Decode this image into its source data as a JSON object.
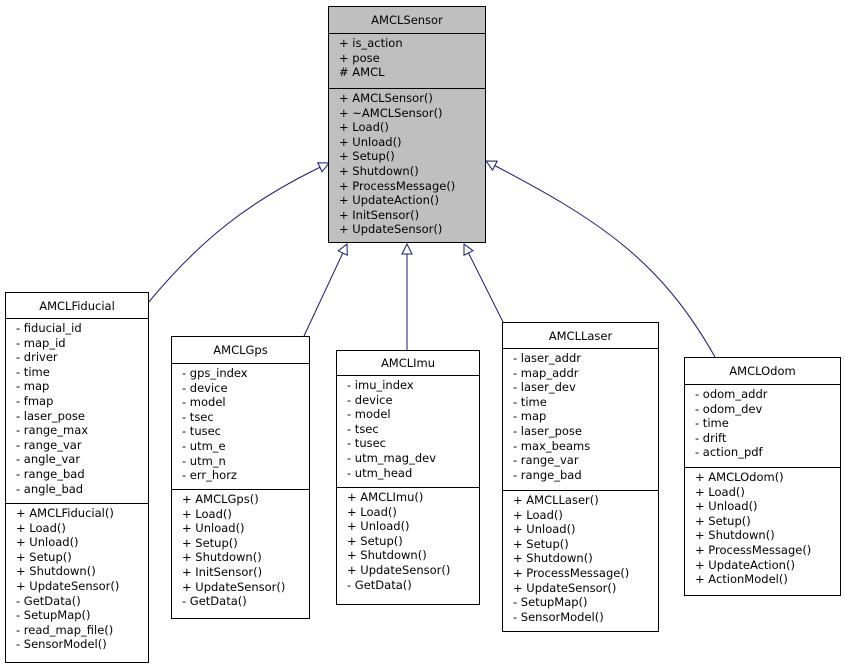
{
  "diagram": {
    "type": "uml-class-inheritance",
    "edge_color": "#191970",
    "base_fill": "#bfbfbf",
    "classes": [
      {
        "id": "AMCLSensor",
        "name": "AMCLSensor",
        "role": "base",
        "attributes": [
          "+ is_action",
          "+ pose",
          "# AMCL"
        ],
        "methods": [
          "+ AMCLSensor()",
          "+ ~AMCLSensor()",
          "+ Load()",
          "+ Unload()",
          "+ Setup()",
          "+ Shutdown()",
          "+ ProcessMessage()",
          "+ UpdateAction()",
          "+ InitSensor()",
          "+ UpdateSensor()"
        ]
      },
      {
        "id": "AMCLFiducial",
        "name": "AMCLFiducial",
        "role": "derived",
        "attributes": [
          "- fiducial_id",
          "- map_id",
          "- driver",
          "- time",
          "- map",
          "- fmap",
          "- laser_pose",
          "- range_max",
          "- range_var",
          "- angle_var",
          "- range_bad",
          "- angle_bad"
        ],
        "methods": [
          "+ AMCLFiducial()",
          "+ Load()",
          "+ Unload()",
          "+ Setup()",
          "+ Shutdown()",
          "+ UpdateSensor()",
          "- GetData()",
          "- SetupMap()",
          "- read_map_file()",
          "- SensorModel()"
        ]
      },
      {
        "id": "AMCLGps",
        "name": "AMCLGps",
        "role": "derived",
        "attributes": [
          "- gps_index",
          "- device",
          "- model",
          "- tsec",
          "- tusec",
          "- utm_e",
          "- utm_n",
          "- err_horz"
        ],
        "methods": [
          "+ AMCLGps()",
          "+ Load()",
          "+ Unload()",
          "+ Setup()",
          "+ Shutdown()",
          "+ InitSensor()",
          "+ UpdateSensor()",
          "- GetData()"
        ]
      },
      {
        "id": "AMCLImu",
        "name": "AMCLImu",
        "role": "derived",
        "attributes": [
          "- imu_index",
          "- device",
          "- model",
          "- tsec",
          "- tusec",
          "- utm_mag_dev",
          "- utm_head"
        ],
        "methods": [
          "+ AMCLImu()",
          "+ Load()",
          "+ Unload()",
          "+ Setup()",
          "+ Shutdown()",
          "+ UpdateSensor()",
          "- GetData()"
        ]
      },
      {
        "id": "AMCLLaser",
        "name": "AMCLLaser",
        "role": "derived",
        "attributes": [
          "- laser_addr",
          "- map_addr",
          "- laser_dev",
          "- time",
          "- map",
          "- laser_pose",
          "- max_beams",
          "- range_var",
          "- range_bad"
        ],
        "methods": [
          "+ AMCLLaser()",
          "+ Load()",
          "+ Unload()",
          "+ Setup()",
          "+ Shutdown()",
          "+ ProcessMessage()",
          "+ UpdateSensor()",
          "- SetupMap()",
          "- SensorModel()"
        ]
      },
      {
        "id": "AMCLOdom",
        "name": "AMCLOdom",
        "role": "derived",
        "attributes": [
          "- odom_addr",
          "- odom_dev",
          "- time",
          "- drift",
          "- action_pdf"
        ],
        "methods": [
          "+ AMCLOdom()",
          "+ Load()",
          "+ Unload()",
          "+ Setup()",
          "+ Shutdown()",
          "+ ProcessMessage()",
          "+ UpdateAction()",
          "+ ActionModel()"
        ]
      }
    ],
    "edges": [
      {
        "from": "AMCLFiducial",
        "to": "AMCLSensor",
        "kind": "inheritance"
      },
      {
        "from": "AMCLGps",
        "to": "AMCLSensor",
        "kind": "inheritance"
      },
      {
        "from": "AMCLImu",
        "to": "AMCLSensor",
        "kind": "inheritance"
      },
      {
        "from": "AMCLLaser",
        "to": "AMCLSensor",
        "kind": "inheritance"
      },
      {
        "from": "AMCLOdom",
        "to": "AMCLSensor",
        "kind": "inheritance"
      }
    ]
  }
}
